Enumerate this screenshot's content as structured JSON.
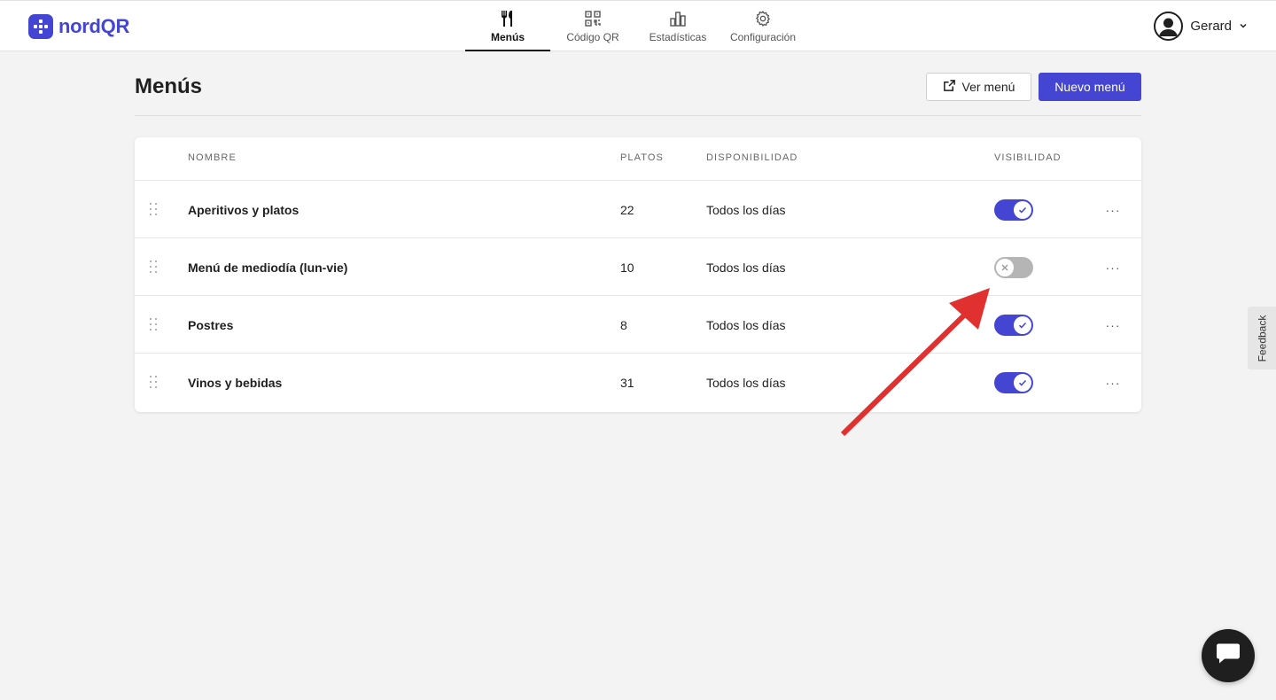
{
  "app": {
    "brand": "nordQR",
    "brand_color": "#4545d4"
  },
  "nav": {
    "items": [
      {
        "label": "Menús",
        "icon": "fork-knife-icon",
        "active": true
      },
      {
        "label": "Código QR",
        "icon": "qr-code-icon",
        "active": false
      },
      {
        "label": "Estadísticas",
        "icon": "bar-chart-icon",
        "active": false
      },
      {
        "label": "Configuración",
        "icon": "gear-icon",
        "active": false
      }
    ]
  },
  "user": {
    "name": "Gerard"
  },
  "page": {
    "title": "Menús",
    "view_menu_label": "Ver menú",
    "new_menu_label": "Nuevo menú"
  },
  "table": {
    "headers": {
      "name": "NOMBRE",
      "dishes": "PLATOS",
      "availability": "DISPONIBILIDAD",
      "visibility": "VISIBILIDAD"
    },
    "rows": [
      {
        "name": "Aperitivos y platos",
        "dishes": "22",
        "availability": "Todos los días",
        "visible": true
      },
      {
        "name": "Menú de mediodía (lun-vie)",
        "dishes": "10",
        "availability": "Todos los días",
        "visible": false
      },
      {
        "name": "Postres",
        "dishes": "8",
        "availability": "Todos los días",
        "visible": true
      },
      {
        "name": "Vinos y bebidas",
        "dishes": "31",
        "availability": "Todos los días",
        "visible": true
      }
    ],
    "more_label": "···"
  },
  "feedback": {
    "label": "Feedback"
  },
  "colors": {
    "accent": "#4545d4",
    "toggle_off": "#b5b5b5",
    "annotation_arrow": "#e03030"
  }
}
